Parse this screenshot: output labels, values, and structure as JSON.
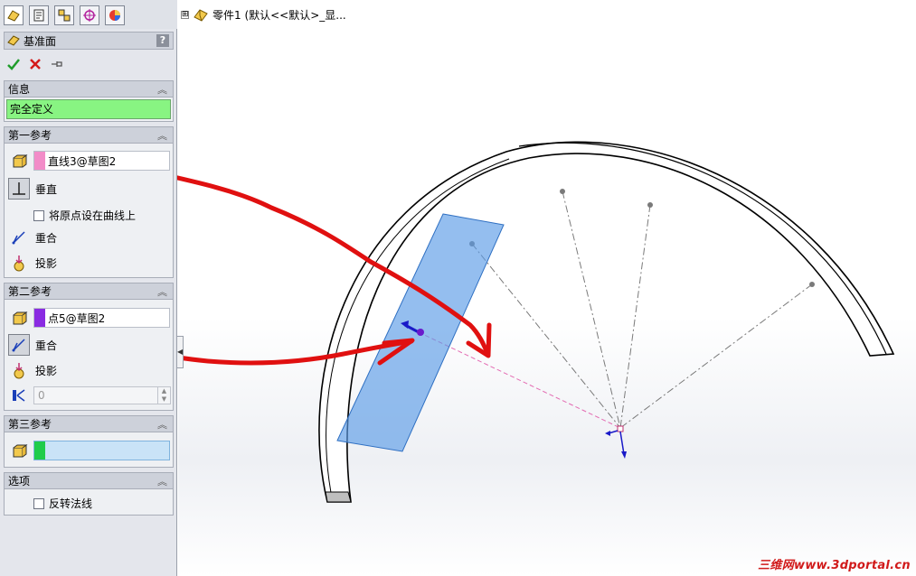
{
  "panel": {
    "title": "基准面",
    "help": "?",
    "info_header": "信息",
    "info_status": "完全定义",
    "first_ref": {
      "header": "第一参考",
      "selection": "直线3@草图2",
      "swatch_color": "#f28cc8",
      "perpendicular_label": "垂直",
      "origin_checkbox_label": "将原点设在曲线上",
      "coincident_label": "重合",
      "project_label": "投影"
    },
    "second_ref": {
      "header": "第二参考",
      "selection": "点5@草图2",
      "swatch_color": "#8a2be2",
      "coincident_label": "重合",
      "project_label": "投影",
      "distance_value": "0"
    },
    "third_ref": {
      "header": "第三参考",
      "selection": "",
      "swatch_color": "#1fcc4a"
    },
    "options": {
      "header": "选项",
      "flip_normal_label": "反转法线"
    }
  },
  "tree": {
    "expander": "⊞",
    "part_label": "零件1 (默认<<默认>_显..."
  },
  "watermark": "三维网www.3dportal.cn",
  "colors": {
    "accent_red": "#e01010",
    "plane_fill": "#5a9be6",
    "status_green": "#88f482"
  }
}
